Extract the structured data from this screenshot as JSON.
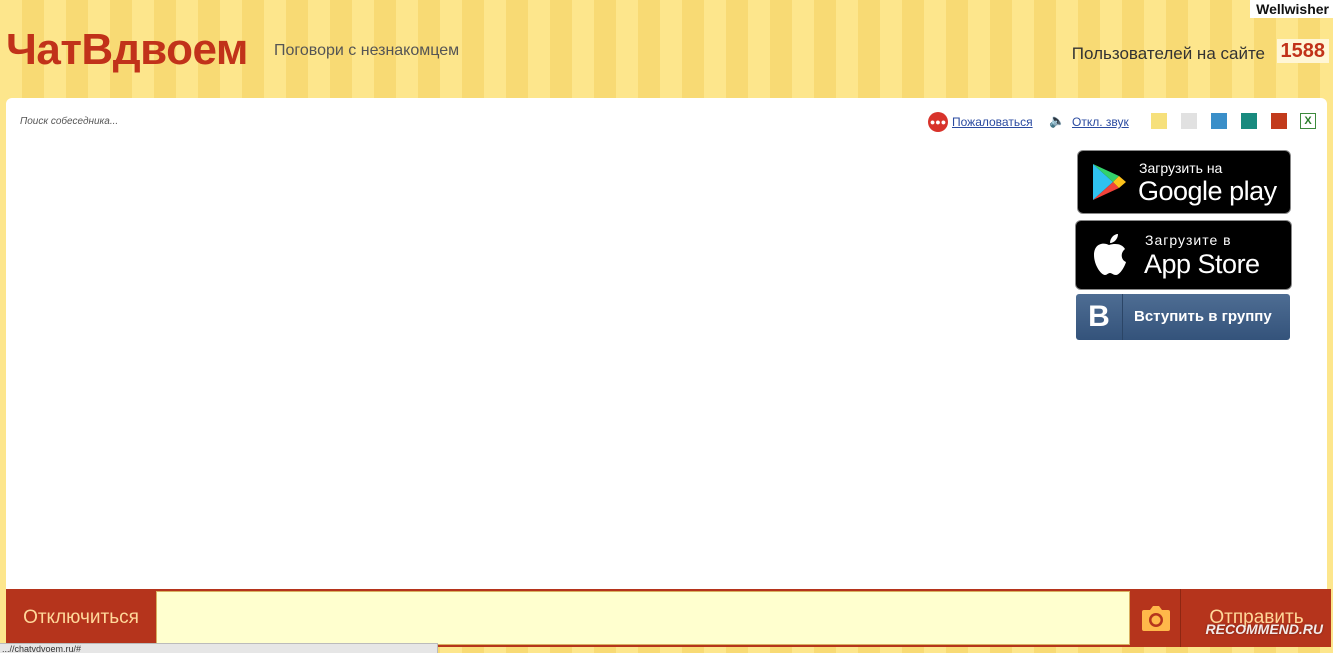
{
  "watermark_top": "Wellwisher",
  "header": {
    "logo": "ЧатВдвоем",
    "tagline": "Поговори с незнакомцем",
    "users_label": "Пользователей на сайте",
    "users_count": "1588"
  },
  "chat": {
    "status_text": "Поиск собеседника...",
    "report_label": "Пожаловаться",
    "mute_label": "Откл. звук",
    "theme_colors": [
      "#f6e07b",
      "#e1e1e1",
      "#3a8fc9",
      "#188a7e",
      "#c23b1c"
    ]
  },
  "apps": {
    "google_small": "Загрузить на",
    "google_big": "Google play",
    "apple_small": "Загрузите в",
    "apple_big": "App Store",
    "vk_letter": "B",
    "vk_label": "Вступить в группу"
  },
  "bottom": {
    "disconnect_label": "Отключиться",
    "message_value": "",
    "send_label": "Отправить"
  },
  "statusbar_url": "...//chatvdvoem.ru/#",
  "watermark_bottom": "RECOMMEND.RU",
  "colors": {
    "brand_red": "#c1321a",
    "bar_red": "#b5341c",
    "input_bg": "#ffffcf",
    "stripe_light": "#fde68c",
    "stripe_dark": "#f8da74"
  }
}
